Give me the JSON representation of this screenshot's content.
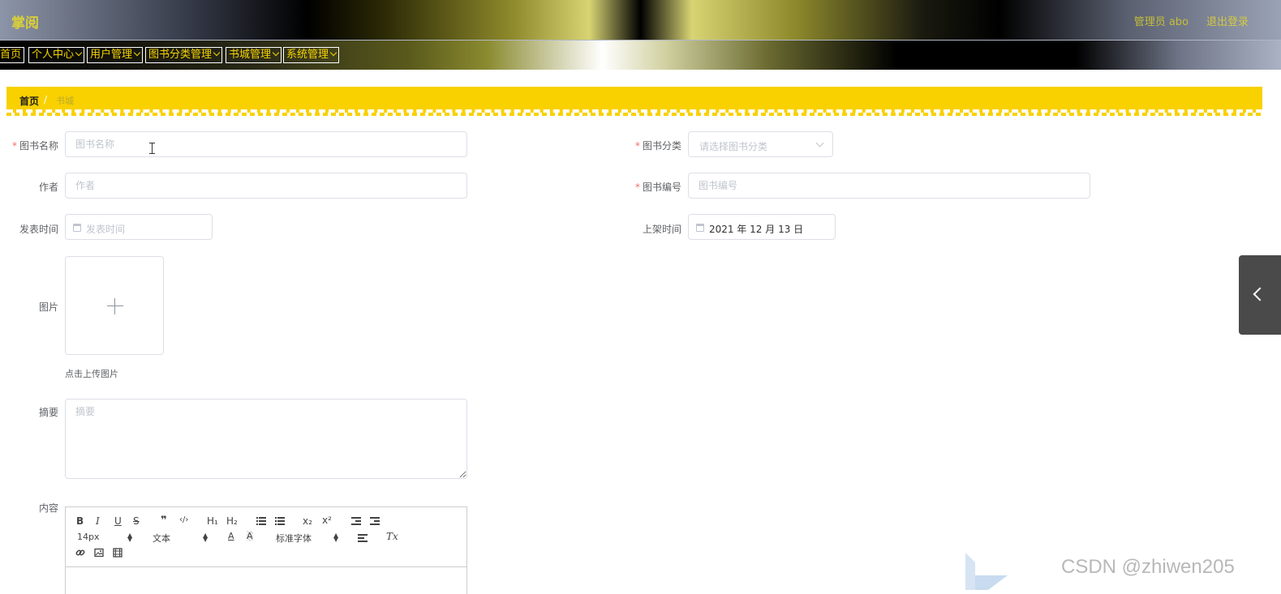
{
  "header": {
    "brand": "掌阅",
    "admin_label": "管理员 abo",
    "logout_label": "退出登录"
  },
  "menu": [
    {
      "label": "首页",
      "has_dropdown": false
    },
    {
      "label": "个人中心",
      "has_dropdown": true
    },
    {
      "label": "用户管理",
      "has_dropdown": true
    },
    {
      "label": "图书分类管理",
      "has_dropdown": true
    },
    {
      "label": "书城管理",
      "has_dropdown": true
    },
    {
      "label": "系统管理",
      "has_dropdown": true
    }
  ],
  "breadcrumb": {
    "home": "首页",
    "separator": "/",
    "current": "书城"
  },
  "form": {
    "book_name": {
      "label": "图书名称",
      "required_mark": "*",
      "placeholder": "图书名称",
      "value": ""
    },
    "category": {
      "label": "图书分类",
      "required_mark": "*",
      "placeholder": "请选择图书分类"
    },
    "author": {
      "label": "作者",
      "placeholder": "作者",
      "value": ""
    },
    "book_no": {
      "label": "图书编号",
      "required_mark": "*",
      "placeholder": "图书编号",
      "value": ""
    },
    "publish_time": {
      "label": "发表时间",
      "placeholder": "发表时间"
    },
    "shelf_time": {
      "label": "上架时间",
      "value": "2021 年 12 月 13 日"
    },
    "image": {
      "label": "图片",
      "upload_tip": "点击上传图片"
    },
    "summary": {
      "label": "摘要",
      "placeholder": "摘要",
      "value": ""
    },
    "content": {
      "label": "内容"
    }
  },
  "editor_toolbar": {
    "bold": "B",
    "italic": "I",
    "underline": "U",
    "strike": "S",
    "blockquote": "❞",
    "code": "‹/›",
    "h1": "H₁",
    "h2": "H₂",
    "subscript": "x₂",
    "superscript": "x²",
    "size": "14px",
    "header_select": "文本",
    "font_color": "A",
    "font_bg": "A",
    "font_family": "标准字体",
    "clean": "Tx"
  },
  "watermark": "CSDN @zhiwen205",
  "colors": {
    "accent_yellow": "#f9d100",
    "required_red": "#f56c6c",
    "menu_text": "#f5d300"
  }
}
